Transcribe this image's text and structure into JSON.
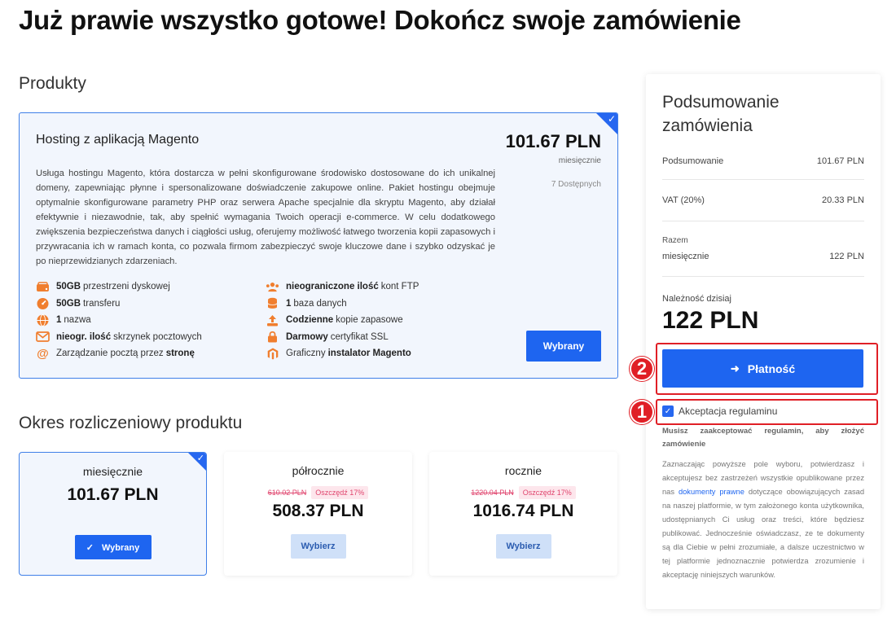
{
  "page": {
    "title": "Już prawie wszystko gotowe! Dokończ swoje zamówienie"
  },
  "products": {
    "section_title": "Produkty",
    "card": {
      "name": "Hosting z aplikacją Magento",
      "price": "101.67 PLN",
      "period": "miesięcznie",
      "availability": "7 Dostępnych",
      "description": "Usługa hostingu Magento, która dostarcza w pełni skonfigurowane środowisko dostosowane do ich unikalnej domeny, zapewniając płynne i spersonalizowane doświadczenie zakupowe online. Pakiet hostingu obejmuje optymalnie skonfigurowane parametry PHP oraz serwera Apache specjalnie dla skryptu Magento, aby działał efektywnie i niezawodnie, tak, aby spełnić wymagania Twoich operacji e-commerce. W celu dodatkowego zwiększenia bezpieczeństwa danych i ciągłości usług, oferujemy możliwość łatwego tworzenia kopii zapasowych i przywracania ich w ramach konta, co pozwala firmom zabezpieczyć swoje kluczowe dane i szybko odzyskać je po nieprzewidzianych zdarzeniach.",
      "selected_button": "Wybrany",
      "features": [
        {
          "bold": "50GB",
          "text": "przestrzeni dyskowej",
          "icon": "disk-icon"
        },
        {
          "bold": "nieograniczone ilość",
          "text": "kont FTP",
          "icon": "users-icon"
        },
        {
          "bold": "50GB",
          "text": "transferu",
          "icon": "speedometer-icon"
        },
        {
          "bold": "1",
          "text": "baza danych",
          "icon": "database-icon"
        },
        {
          "bold": "1",
          "text": "nazwa",
          "icon": "globe-icon"
        },
        {
          "bold": "Codzienne",
          "text": "kopie zapasowe",
          "icon": "upload-icon"
        },
        {
          "bold": "nieogr. ilość",
          "text": "skrzynek pocztowych",
          "icon": "envelope-icon"
        },
        {
          "bold": "Darmowy",
          "text": "certyfikat SSL",
          "icon": "lock-icon"
        },
        {
          "text": "Zarządzanie pocztą przez",
          "tail_bold": "stronę",
          "icon": "at-icon"
        },
        {
          "text": "Graficzny",
          "tail_bold": "instalator Magento",
          "icon": "magento-icon"
        }
      ]
    }
  },
  "billing": {
    "section_title": "Okres rozliczeniowy produktu",
    "options": [
      {
        "label": "miesięcznie",
        "price": "101.67 PLN",
        "old_price": "",
        "save": "",
        "button": "Wybrany",
        "selected": true
      },
      {
        "label": "półrocznie",
        "price": "508.37 PLN",
        "old_price": "610.02 PLN",
        "save": "Oszczędź 17%",
        "button": "Wybierz",
        "selected": false
      },
      {
        "label": "rocznie",
        "price": "1016.74 PLN",
        "old_price": "1220.04 PLN",
        "save": "Oszczędź 17%",
        "button": "Wybierz",
        "selected": false
      }
    ]
  },
  "summary": {
    "title": "Podsumowanie zamówienia",
    "subtotal_label": "Podsumowanie",
    "subtotal_value": "101.67 PLN",
    "vat_label": "VAT (20%)",
    "vat_value": "20.33 PLN",
    "total_caption": "Razem",
    "total_label": "miesięcznie",
    "total_value": "122 PLN",
    "due_label": "Należność dzisiaj",
    "due_amount": "122 PLN",
    "pay_button": "Płatność",
    "terms_label": "Akceptacja regulaminu",
    "terms_warning": "Musisz zaakceptować regulamin, aby złożyć zamówienie",
    "terms_text_before": "Zaznaczając powyższe pole wyboru, potwierdzasz i akceptujesz bez zastrzeżeń wszystkie opublikowane przez nas",
    "terms_link": "dokumenty prawne",
    "terms_text_after": "dotyczące obowiązujących zasad na naszej platformie, w tym założonego konta użytkownika, udostępnianych Ci usług oraz treści, które będziesz publikować. Jednocześnie oświadczasz, ze te dokumenty są dla Ciebie w pełni zrozumiałe, a dalsze uczestnictwo w tej platformie jednoznacznie potwierdza zrozumienie i akceptację niniejszych warunków."
  },
  "annotations": {
    "badge_pay": "2",
    "badge_terms": "1"
  },
  "colors": {
    "accent": "#1e65f0",
    "highlight": "#e01f26",
    "discount": "#e0456e",
    "feature_icon": "#f07e2e"
  }
}
